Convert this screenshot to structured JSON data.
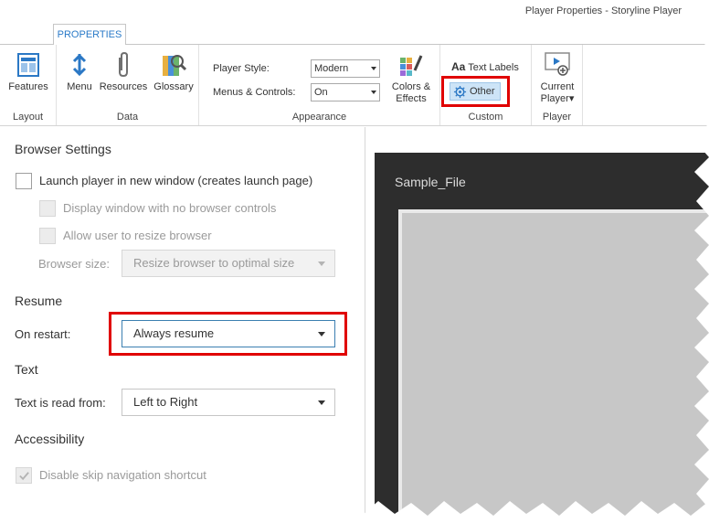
{
  "window": {
    "title": "Player Properties - Storyline Player"
  },
  "ribbon": {
    "tab_label": "PROPERTIES",
    "groups": {
      "layout": {
        "label": "Layout",
        "features_label": "Features"
      },
      "data": {
        "label": "Data",
        "menu_label": "Menu",
        "resources_label": "Resources",
        "glossary_label": "Glossary"
      },
      "appearance": {
        "label": "Appearance",
        "player_style_label": "Player Style:",
        "player_style_value": "Modern",
        "menus_controls_label": "Menus & Controls:",
        "menus_controls_value": "On",
        "colors_label_1": "Colors &",
        "colors_label_2": "Effects"
      },
      "custom": {
        "label": "Custom",
        "text_labels_glyph": "Aa",
        "text_labels_label": "Text Labels",
        "other_label": "Other"
      },
      "player": {
        "label": "Player",
        "current_label_1": "Current",
        "current_label_2": "Player"
      }
    }
  },
  "settings": {
    "browser": {
      "title": "Browser Settings",
      "launch_new_window": "Launch player in new window (creates launch page)",
      "no_browser_controls": "Display window with no browser controls",
      "allow_resize": "Allow user to resize browser",
      "browser_size_label": "Browser size:",
      "browser_size_value": "Resize browser to optimal size"
    },
    "resume": {
      "title": "Resume",
      "on_restart_label": "On restart:",
      "on_restart_value": "Always resume"
    },
    "text": {
      "title": "Text",
      "read_from_label": "Text is read from:",
      "read_from_value": "Left to Right"
    },
    "accessibility": {
      "title": "Accessibility",
      "disable_skip_nav": "Disable skip navigation shortcut"
    }
  },
  "preview": {
    "title": "Sample_File"
  },
  "colors": {
    "accent_tab": "#2a7ac8",
    "highlight": "#e00000",
    "preview_bg": "#2d2d2d",
    "slide_bg": "#c7c7c7"
  }
}
